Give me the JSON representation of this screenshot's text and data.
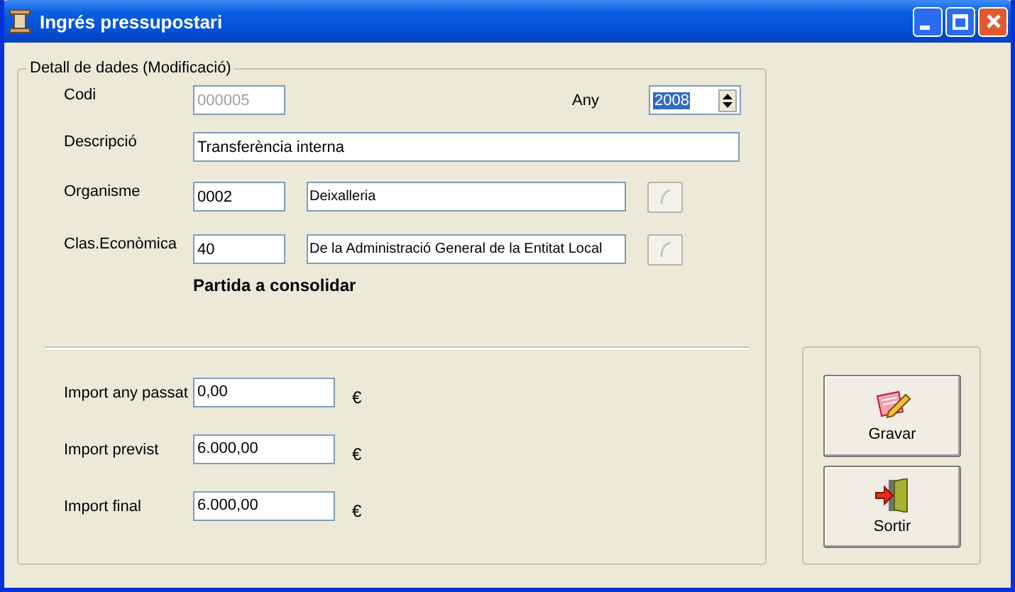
{
  "window": {
    "title": "Ingrés pressupostari"
  },
  "group": {
    "title": "Detall de dades (Modificació)"
  },
  "codi": {
    "label": "Codi",
    "value": "000005",
    "disabled": true
  },
  "any": {
    "label": "Any",
    "value": "2008",
    "selected": true
  },
  "descripcio": {
    "label": "Descripció",
    "value": "Transferència interna"
  },
  "lookups": [
    {
      "label": "Organisme",
      "code": "0002",
      "name": "Deixalleria"
    },
    {
      "label": "Clas.Econòmica",
      "code": "40",
      "name": "De la Administració General de la Entitat Local"
    }
  ],
  "note": "Partida a consolidar",
  "amounts": [
    {
      "label": "Import any passat",
      "value": "0,00",
      "unit": "€"
    },
    {
      "label": "Import previst",
      "value": "6.000,00",
      "unit": "€"
    },
    {
      "label": "Import final",
      "value": "6.000,00",
      "unit": "€"
    }
  ],
  "buttons": [
    {
      "label": "Gravar",
      "kind": "save"
    },
    {
      "label": "Sortir",
      "kind": "exit"
    }
  ]
}
